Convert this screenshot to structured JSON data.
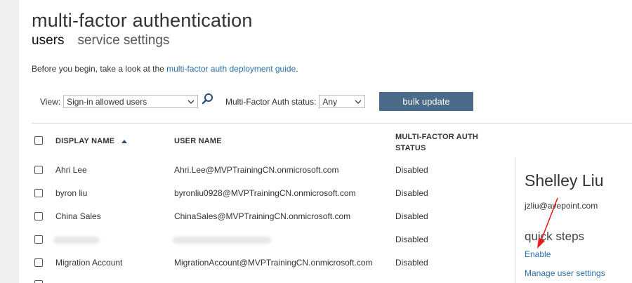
{
  "page": {
    "title": "multi-factor authentication",
    "tabs": [
      {
        "label": "users",
        "active": true
      },
      {
        "label": "service settings",
        "active": false
      }
    ],
    "intro_text": "Before you begin, take a look at the ",
    "intro_link": "multi-factor auth deployment guide",
    "intro_end": "."
  },
  "filters": {
    "view_label": "View:",
    "view_value": "Sign-in allowed users",
    "status_label": "Multi-Factor Auth status:",
    "status_value": "Any",
    "bulk_update_label": "bulk update"
  },
  "table": {
    "headers": {
      "display_name": "DISPLAY NAME",
      "user_name": "USER NAME",
      "mfa_status_line1": "MULTI-FACTOR AUTH",
      "mfa_status_line2": "STATUS"
    },
    "rows": [
      {
        "display_name": "Ahri Lee",
        "user_name": "Ahri.Lee@MVPTrainingCN.onmicrosoft.com",
        "status": "Disabled"
      },
      {
        "display_name": "byron liu",
        "user_name": "byronliu0928@MVPTrainingCN.onmicrosoft.com",
        "status": "Disabled"
      },
      {
        "display_name": "China Sales",
        "user_name": "ChinaSales@MVPTrainingCN.onmicrosoft.com",
        "status": "Disabled"
      },
      {
        "display_name": "",
        "user_name": "",
        "status": "Disabled"
      },
      {
        "display_name": "Migration Account",
        "user_name": "MigrationAccount@MVPTrainingCN.onmicrosoft.com",
        "status": "Disabled"
      }
    ]
  },
  "detail": {
    "name": "Shelley Liu",
    "email": "jzliu@avepoint.com",
    "quick_steps_label": "quick steps",
    "enable_label": "Enable",
    "manage_label": "Manage user settings"
  },
  "colors": {
    "accent_link": "#2d6ea8",
    "button_bg": "#4a6a8a",
    "annotation_arrow": "#e02020"
  }
}
